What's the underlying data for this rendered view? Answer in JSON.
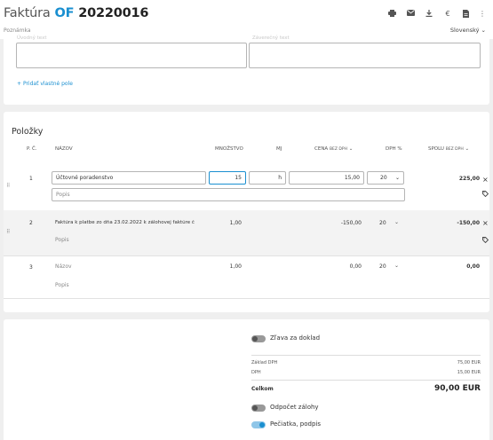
{
  "header": {
    "title_prefix": "Faktúra",
    "title_of": "OF",
    "title_number": "20220016",
    "subtitle": "Poznámka",
    "language": "Slovenský"
  },
  "notes": {
    "intro_label": "Úvodný text",
    "closing_label": "Záverečný text",
    "add_custom_field": "Pridať vlastné pole"
  },
  "items": {
    "title": "Položky",
    "columns": {
      "no": "P. Č.",
      "name": "NÁZOV",
      "qty": "MNOŽSTVO",
      "unit": "MJ",
      "price": "CENA",
      "price_sub": "BEZ DPH",
      "vat": "DPH %",
      "total": "SPOLU",
      "total_sub": "BEZ DPH"
    },
    "rows": [
      {
        "no": "1",
        "name": "Účtovné poradenstvo",
        "description_placeholder": "Popis",
        "qty": "15",
        "unit": "h",
        "price": "15,00",
        "vat": "20",
        "total": "225,00"
      },
      {
        "no": "2",
        "name": "Faktúra k platbe zo dňa 23.02.2022 k zálohovej faktúre č",
        "description_placeholder": "Popis",
        "qty": "1,00",
        "unit": "",
        "price": "-150,00",
        "vat": "20",
        "total": "-150,00"
      },
      {
        "no": "3",
        "name": "Názov",
        "description_placeholder": "Popis",
        "qty": "1,00",
        "unit": "",
        "price": "0,00",
        "vat": "20",
        "total": "0,00"
      }
    ]
  },
  "summary": {
    "discount_label": "Zľava za doklad",
    "base_label": "Základ DPH",
    "base_value": "75,00 EUR",
    "vat_label": "DPH",
    "vat_value": "15,00 EUR",
    "total_label": "Celkom",
    "total_value": "90,00 EUR",
    "advance_label": "Odpočet zálohy",
    "stamp_label": "Pečiatka, podpis"
  }
}
